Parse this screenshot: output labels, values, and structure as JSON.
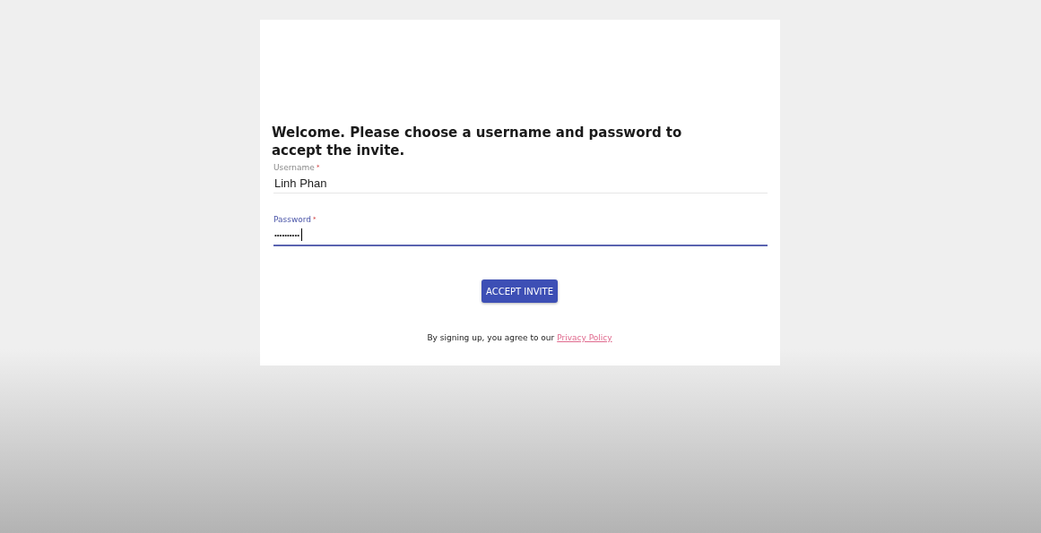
{
  "heading": "Welcome. Please choose a username and password to accept the invite.",
  "fields": [
    {
      "label": "Username",
      "required_mark": "*",
      "value": "Linh Phan",
      "focused": false
    },
    {
      "label": "Password",
      "required_mark": "*",
      "value": "••••••••••",
      "focused": true
    }
  ],
  "button": "ACCEPT INVITE",
  "footer": {
    "text": "By signing up, you agree to our",
    "link": "Privacy Policy"
  }
}
